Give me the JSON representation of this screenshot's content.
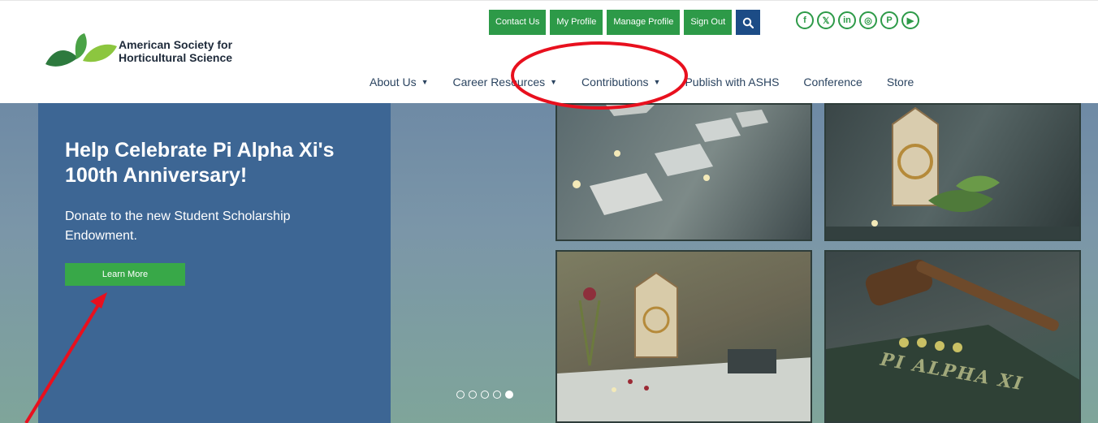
{
  "brand": {
    "name": "American Society for Horticultural Science",
    "name_line1": "American Society for",
    "name_line2": "Horticultural Science",
    "colors": {
      "green": "#2d9a48",
      "navy": "#1c4c86",
      "panel": "#3d6694"
    }
  },
  "utility": {
    "contact": "Contact Us",
    "my_profile": "My Profile",
    "manage_profile": "Manage Profile",
    "sign_out": "Sign Out",
    "search_icon": "search-icon"
  },
  "social": [
    {
      "icon": "facebook-icon",
      "glyph": "f"
    },
    {
      "icon": "x-icon",
      "glyph": "𝕏"
    },
    {
      "icon": "linkedin-icon",
      "glyph": "in"
    },
    {
      "icon": "instagram-icon",
      "glyph": "◎"
    },
    {
      "icon": "pinterest-icon",
      "glyph": "P"
    },
    {
      "icon": "youtube-icon",
      "glyph": "▶"
    }
  ],
  "nav": [
    {
      "label": "About Us",
      "dropdown": true
    },
    {
      "label": "Career Resources",
      "dropdown": true
    },
    {
      "label": "Contributions",
      "dropdown": true
    },
    {
      "label": "Publish with ASHS",
      "dropdown": false
    },
    {
      "label": "Conference",
      "dropdown": false
    },
    {
      "label": "Store",
      "dropdown": false
    }
  ],
  "hero": {
    "title": "Help Celebrate Pi Alpha Xi's 100th Anniversary!",
    "subtitle": "Donate to the new Student Scholarship Endowment.",
    "cta": "Learn More",
    "slides_total": 5,
    "slide_active": 5,
    "photo_caption": "PI ALPHA XI"
  },
  "annotations": {
    "highlight_color": "#e8101e"
  }
}
